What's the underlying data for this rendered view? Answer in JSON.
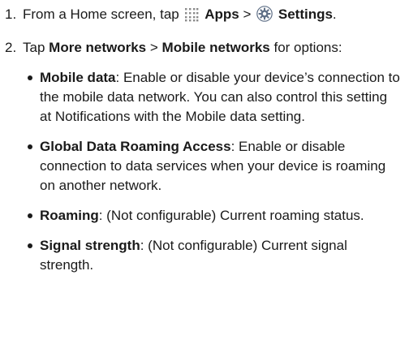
{
  "steps": [
    {
      "number": "1.",
      "prefix": "From a Home screen, tap",
      "apps_icon": "apps-grid-icon",
      "apps_label": "Apps",
      "separator": ">",
      "settings_icon": "settings-gear-icon",
      "settings_label": "Settings",
      "suffix": "."
    },
    {
      "number": "2.",
      "prefix": "Tap",
      "more_networks_label": "More networks",
      "separator": ">",
      "mobile_networks_label": "Mobile networks",
      "suffix": "for options:"
    }
  ],
  "options": [
    {
      "term": "Mobile data",
      "description": ": Enable or disable your device’s connection to the mobile data network. You can also control this setting at Notifications with the Mobile data setting."
    },
    {
      "term": "Global Data Roaming Access",
      "description": ": Enable or disable connection to data services when your device is roaming on another network."
    },
    {
      "term": "Roaming",
      "description": ": (Not configurable) Current roaming status."
    },
    {
      "term": "Signal strength",
      "description": ": (Not configurable) Current signal strength."
    }
  ]
}
